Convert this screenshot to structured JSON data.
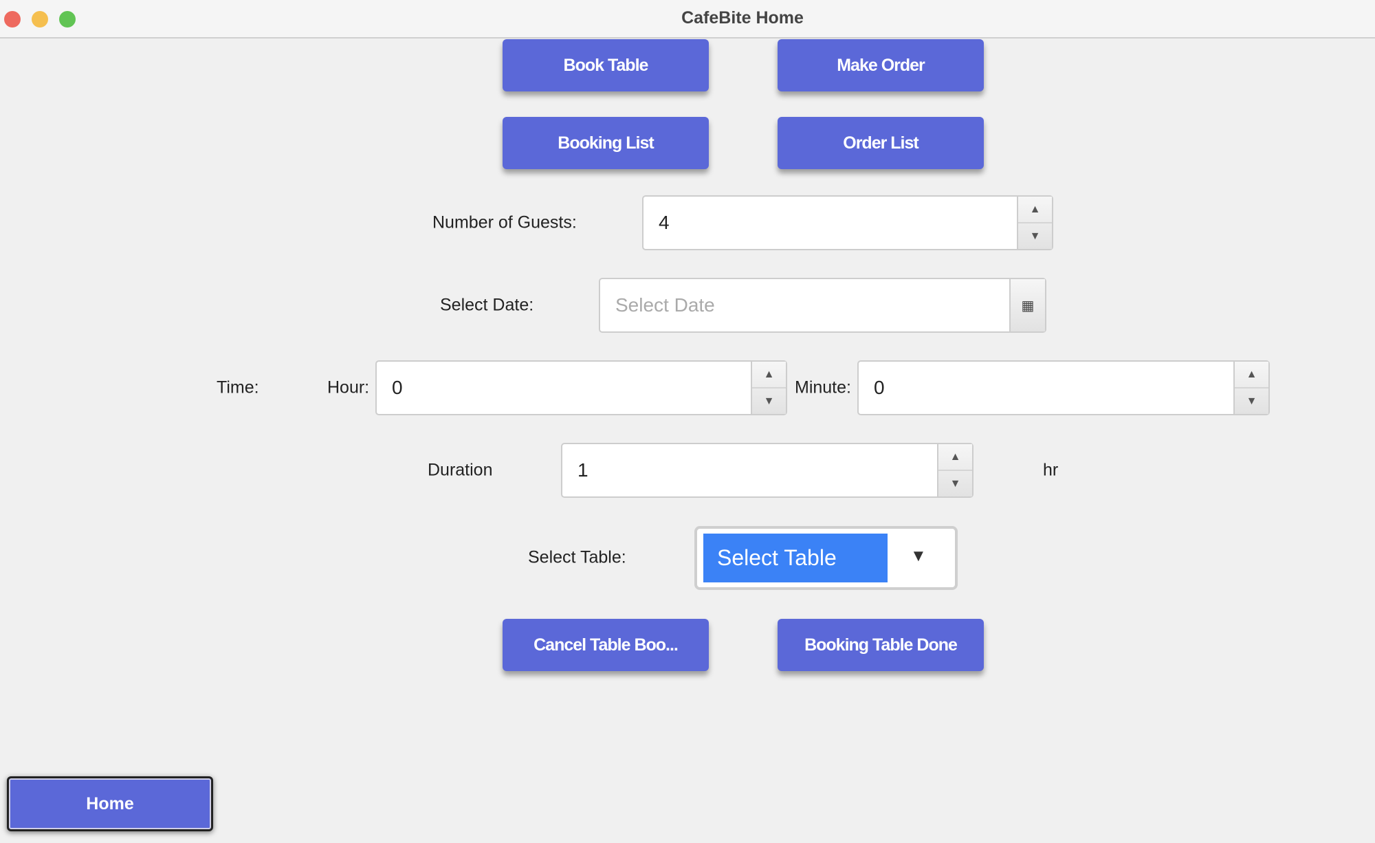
{
  "window": {
    "title": "CafeBite Home"
  },
  "nav": {
    "book_table": "Book Table",
    "make_order": "Make Order",
    "booking_list": "Booking List",
    "order_list": "Order List"
  },
  "form": {
    "guests_label": "Number of Guests:",
    "guests_value": "4",
    "date_label": "Select Date:",
    "date_placeholder": "Select Date",
    "time_label": "Time:",
    "hour_label": "Hour:",
    "hour_value": "0",
    "minute_label": "Minute:",
    "minute_value": "0",
    "duration_label": "Duration",
    "duration_value": "1",
    "duration_unit": "hr",
    "table_label": "Select Table:",
    "table_value": "Select Table"
  },
  "actions": {
    "cancel": "Cancel Table Boo...",
    "done": "Booking Table Done",
    "home": "Home"
  },
  "colors": {
    "button": "#5b68d8",
    "combo_selected": "#3b82f6"
  }
}
